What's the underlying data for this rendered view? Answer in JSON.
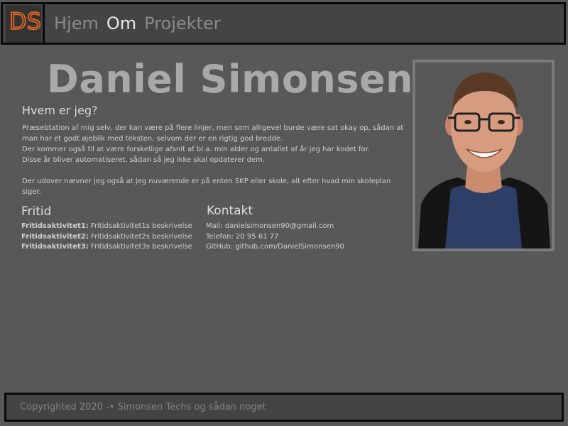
{
  "nav": {
    "logo_text": "DS",
    "links": [
      {
        "label": "Hjem",
        "active": false
      },
      {
        "label": "Om",
        "active": true
      },
      {
        "label": "Projekter",
        "active": false
      }
    ]
  },
  "main": {
    "title": "Daniel Simonsen",
    "about_heading": "Hvem er jeg?",
    "about_paragraph_1": "Præsebtation af mig selv, der kan være på flere linjer, men som alligevel burde være sat okay op, sådan at man har et godt øjeblik med teksten, selvom der er en rigtig god bredde.",
    "about_paragraph_2": "Der kommer også til at være forskellige afsnit af bl.a. min alder og antallet af år jeg har kodet for.",
    "about_paragraph_3": "Disse år bliver automatiseret, sådan så jeg ikke skal opdaterer dem.",
    "about_paragraph_4": "Der udover nævner jeg også at jeg nuværende er på enten SKP eller skole, alt efter hvad min skoleplan siger."
  },
  "fritid": {
    "heading": "Fritid",
    "items": [
      {
        "name": "Fritidsaktivitet1:",
        "desc": "Fritidsaktivitet1s beskrivelse"
      },
      {
        "name": "Fritidsaktivitet2:",
        "desc": "Fritidsaktivitet2s beskrivelse"
      },
      {
        "name": "Fritidsaktivitet3:",
        "desc": "Fritidsaktivitet3s beskrivelse"
      }
    ]
  },
  "kontakt": {
    "heading": "Kontakt",
    "mail": "Mail: danielsimonsen90@gmail.com",
    "phone": "Telefon: 20 95 61 77",
    "github": "GitHub: github.com/DanielSimonsen90"
  },
  "footer": {
    "text": "Copyrighted 2020 -• Simonsen Techs og sådan noget"
  },
  "colors": {
    "background": "#585858",
    "bar": "#444444",
    "logo_orange": "#e8661c"
  }
}
